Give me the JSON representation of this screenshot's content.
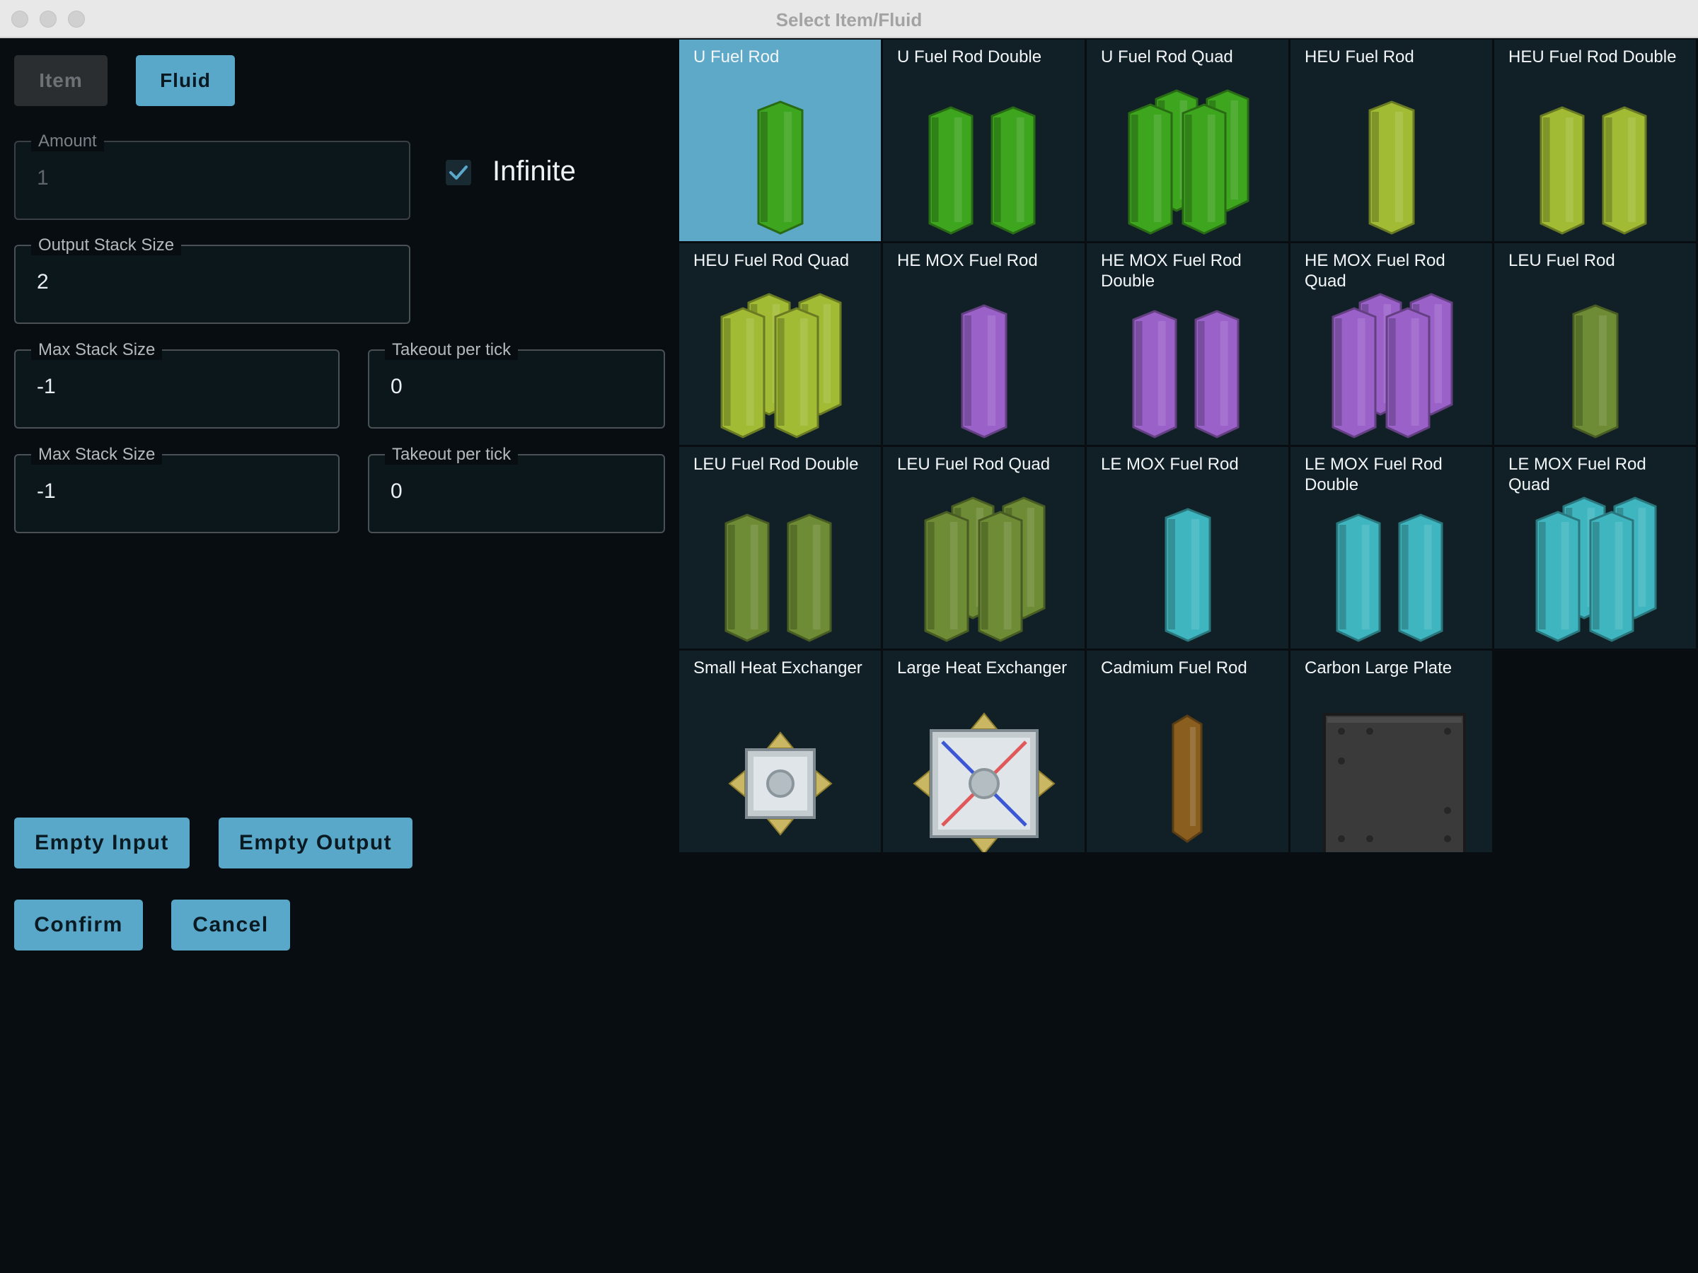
{
  "window": {
    "title": "Select Item/Fluid"
  },
  "tabs": {
    "item": "Item",
    "fluid": "Fluid",
    "active": "Fluid"
  },
  "form": {
    "amount": {
      "label": "Amount",
      "value": "1",
      "disabled": true
    },
    "infinite": {
      "label": "Infinite",
      "checked": true
    },
    "output_stack": {
      "label": "Output Stack Size",
      "value": "2"
    },
    "rows": [
      {
        "max_label": "Max Stack Size",
        "max_value": "-1",
        "takeout_label": "Takeout per tick",
        "takeout_value": "0"
      },
      {
        "max_label": "Max Stack Size",
        "max_value": "-1",
        "takeout_label": "Takeout per tick",
        "takeout_value": "0"
      }
    ]
  },
  "buttons": {
    "empty_input": "Empty Input",
    "empty_output": "Empty Output",
    "confirm": "Confirm",
    "cancel": "Cancel"
  },
  "colors": {
    "accent": "#5aa8c9",
    "background": "#070d11",
    "cell": "#102026",
    "u": "#3ea51f",
    "heu": "#a1bb35",
    "mox_he": "#9a62c9",
    "leu": "#6d8c35",
    "mox_le": "#3fb6bf",
    "cadmium": "#8a5e1e"
  },
  "items": [
    {
      "name": "U Fuel Rod",
      "icon": "u-fuel-rod-icon",
      "selected": true
    },
    {
      "name": "U Fuel Rod Double",
      "icon": "u-fuel-rod-double-icon"
    },
    {
      "name": "U Fuel Rod Quad",
      "icon": "u-fuel-rod-quad-icon"
    },
    {
      "name": "HEU Fuel Rod",
      "icon": "heu-fuel-rod-icon"
    },
    {
      "name": "HEU Fuel Rod Double",
      "icon": "heu-fuel-rod-double-icon"
    },
    {
      "name": "HEU Fuel Rod Quad",
      "icon": "heu-fuel-rod-quad-icon"
    },
    {
      "name": "HE MOX Fuel Rod",
      "icon": "he-mox-fuel-rod-icon"
    },
    {
      "name": "HE MOX Fuel Rod Double",
      "icon": "he-mox-fuel-rod-double-icon"
    },
    {
      "name": "HE MOX Fuel Rod Quad",
      "icon": "he-mox-fuel-rod-quad-icon"
    },
    {
      "name": "LEU Fuel Rod",
      "icon": "leu-fuel-rod-icon"
    },
    {
      "name": "LEU Fuel Rod Double",
      "icon": "leu-fuel-rod-double-icon"
    },
    {
      "name": "LEU Fuel Rod Quad",
      "icon": "leu-fuel-rod-quad-icon"
    },
    {
      "name": "LE MOX Fuel Rod",
      "icon": "le-mox-fuel-rod-icon"
    },
    {
      "name": "LE MOX Fuel Rod Double",
      "icon": "le-mox-fuel-rod-double-icon"
    },
    {
      "name": "LE MOX Fuel Rod Quad",
      "icon": "le-mox-fuel-rod-quad-icon"
    },
    {
      "name": "Small Heat Exchanger",
      "icon": "small-heat-exchanger-icon"
    },
    {
      "name": "Large Heat Exchanger",
      "icon": "large-heat-exchanger-icon"
    },
    {
      "name": "Cadmium Fuel Rod",
      "icon": "cadmium-fuel-rod-icon"
    },
    {
      "name": "Carbon Large Plate",
      "icon": "carbon-large-plate-icon"
    }
  ]
}
